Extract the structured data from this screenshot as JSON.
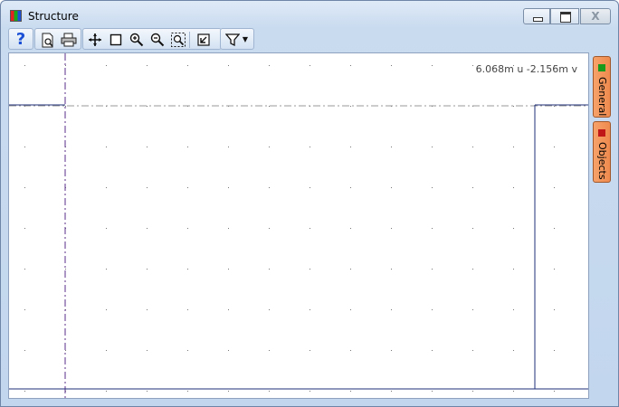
{
  "window": {
    "title": "Structure"
  },
  "window_controls": {
    "minimize_label": "",
    "maximize_label": "",
    "close_label": "X"
  },
  "toolbar": {
    "help": "?",
    "tools": [
      "help-icon",
      "print-preview-icon",
      "print-icon",
      "pan-icon",
      "select-rectangle-icon",
      "zoom-in-icon",
      "zoom-out-icon",
      "zoom-extents-icon",
      "reset-view-icon",
      "filter-icon"
    ]
  },
  "canvas": {
    "coordinate_readout": "6.068m u -2.156m v",
    "background": "#ffffff",
    "grid_color": "#777777",
    "axis_color": "#5a2e8a"
  },
  "side_tabs": [
    {
      "label": "General",
      "indicator_color": "#1a9a1a",
      "tab_color": "#f4995f"
    },
    {
      "label": "Objects",
      "indicator_color": "#c01818",
      "tab_color": "#f4995f"
    }
  ]
}
